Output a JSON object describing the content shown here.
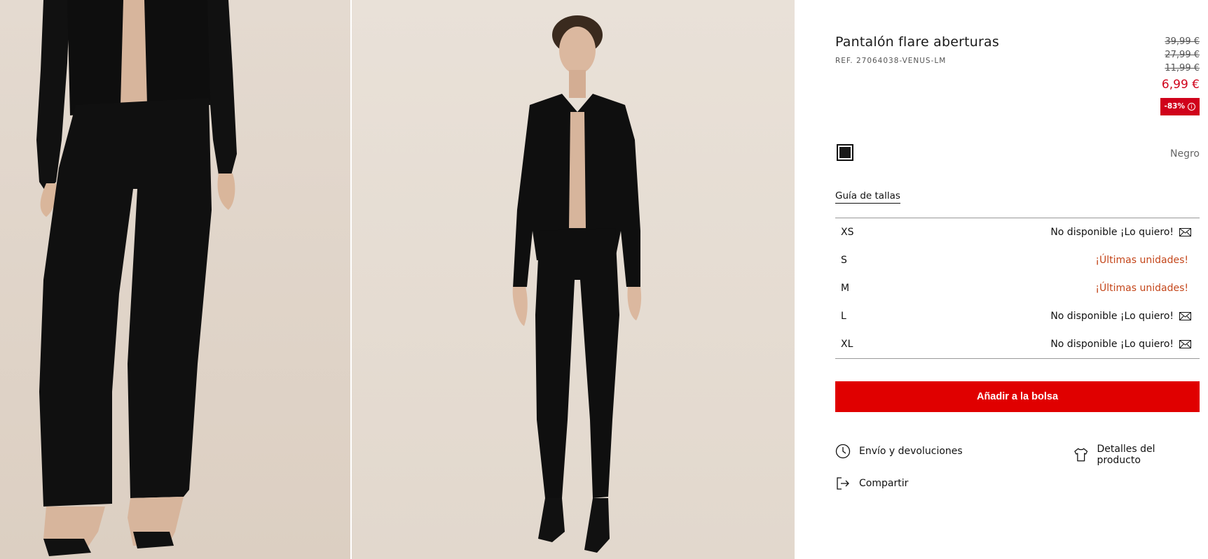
{
  "gallery": {
    "images": [
      {
        "alt": "photo-closeup-trousers"
      },
      {
        "alt": "photo-full-outfit"
      }
    ]
  },
  "product": {
    "title": "Pantalón flare aberturas",
    "ref": "REF. 27064038-VENUS-LM",
    "prices": {
      "old": [
        "39,99 €",
        "27,99 €",
        "11,99 €"
      ],
      "current": "6,99 €",
      "discount": "-83%",
      "discount_info_icon": "info-icon"
    },
    "color": {
      "name": "Negro",
      "swatch": "#1a1a1a"
    },
    "size_guide_label": "Guía de tallas",
    "sizes": [
      {
        "label": "XS",
        "status": "No disponible ¡Lo quiero!",
        "available": false,
        "icon": "mail-icon"
      },
      {
        "label": "S",
        "status": "¡Últimas unidades!",
        "available": true
      },
      {
        "label": "M",
        "status": "¡Últimas unidades!",
        "available": true
      },
      {
        "label": "L",
        "status": "No disponible ¡Lo quiero!",
        "available": false,
        "icon": "mail-icon"
      },
      {
        "label": "XL",
        "status": "No disponible ¡Lo quiero!",
        "available": false,
        "icon": "mail-icon"
      }
    ],
    "add_to_bag": "Añadir a la bolsa"
  },
  "links": {
    "shipping": {
      "label": "Envío y devoluciones",
      "icon": "clock-icon"
    },
    "details": {
      "label": "Detalles del producto",
      "icon": "tshirt-icon"
    },
    "share": {
      "label": "Compartir",
      "icon": "share-icon"
    }
  },
  "colors": {
    "accent_red": "#e00000",
    "price_red": "#d0021b",
    "last_units": "#c4461a",
    "photo_bg": "#e4dad0"
  }
}
